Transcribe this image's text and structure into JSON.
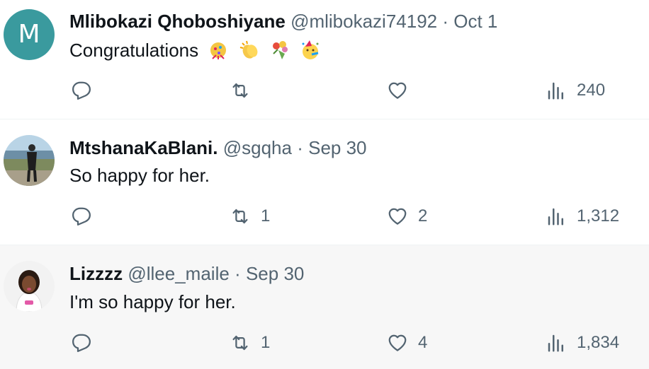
{
  "tweets": [
    {
      "avatar_letter": "M",
      "name": "Mlibokazi Qhoboshiyane",
      "handle": "@mlibokazi74192",
      "date": "Oct 1",
      "text": "Congratulations",
      "emojis": [
        "confetti-icon",
        "clapping-hands-icon",
        "bouquet-icon",
        "party-face-icon"
      ],
      "retweets": "",
      "likes": "",
      "views": "240"
    },
    {
      "name": "MtshanaKaBlani.",
      "handle": "@sgqha",
      "date": "Sep 30",
      "text": "So happy for her.",
      "retweets": "1",
      "likes": "2",
      "views": "1,312"
    },
    {
      "name": "Lizzzz",
      "handle": "@llee_maile",
      "date": "Sep 30",
      "text": "I'm so happy for her.",
      "retweets": "1",
      "likes": "4",
      "views": "1,834"
    }
  ],
  "separator": "·",
  "colors": {
    "text": "#0f1419",
    "secondary": "#536471",
    "avatar_teal": "#3a9a9e",
    "highlight_bg": "#f7f7f7"
  }
}
